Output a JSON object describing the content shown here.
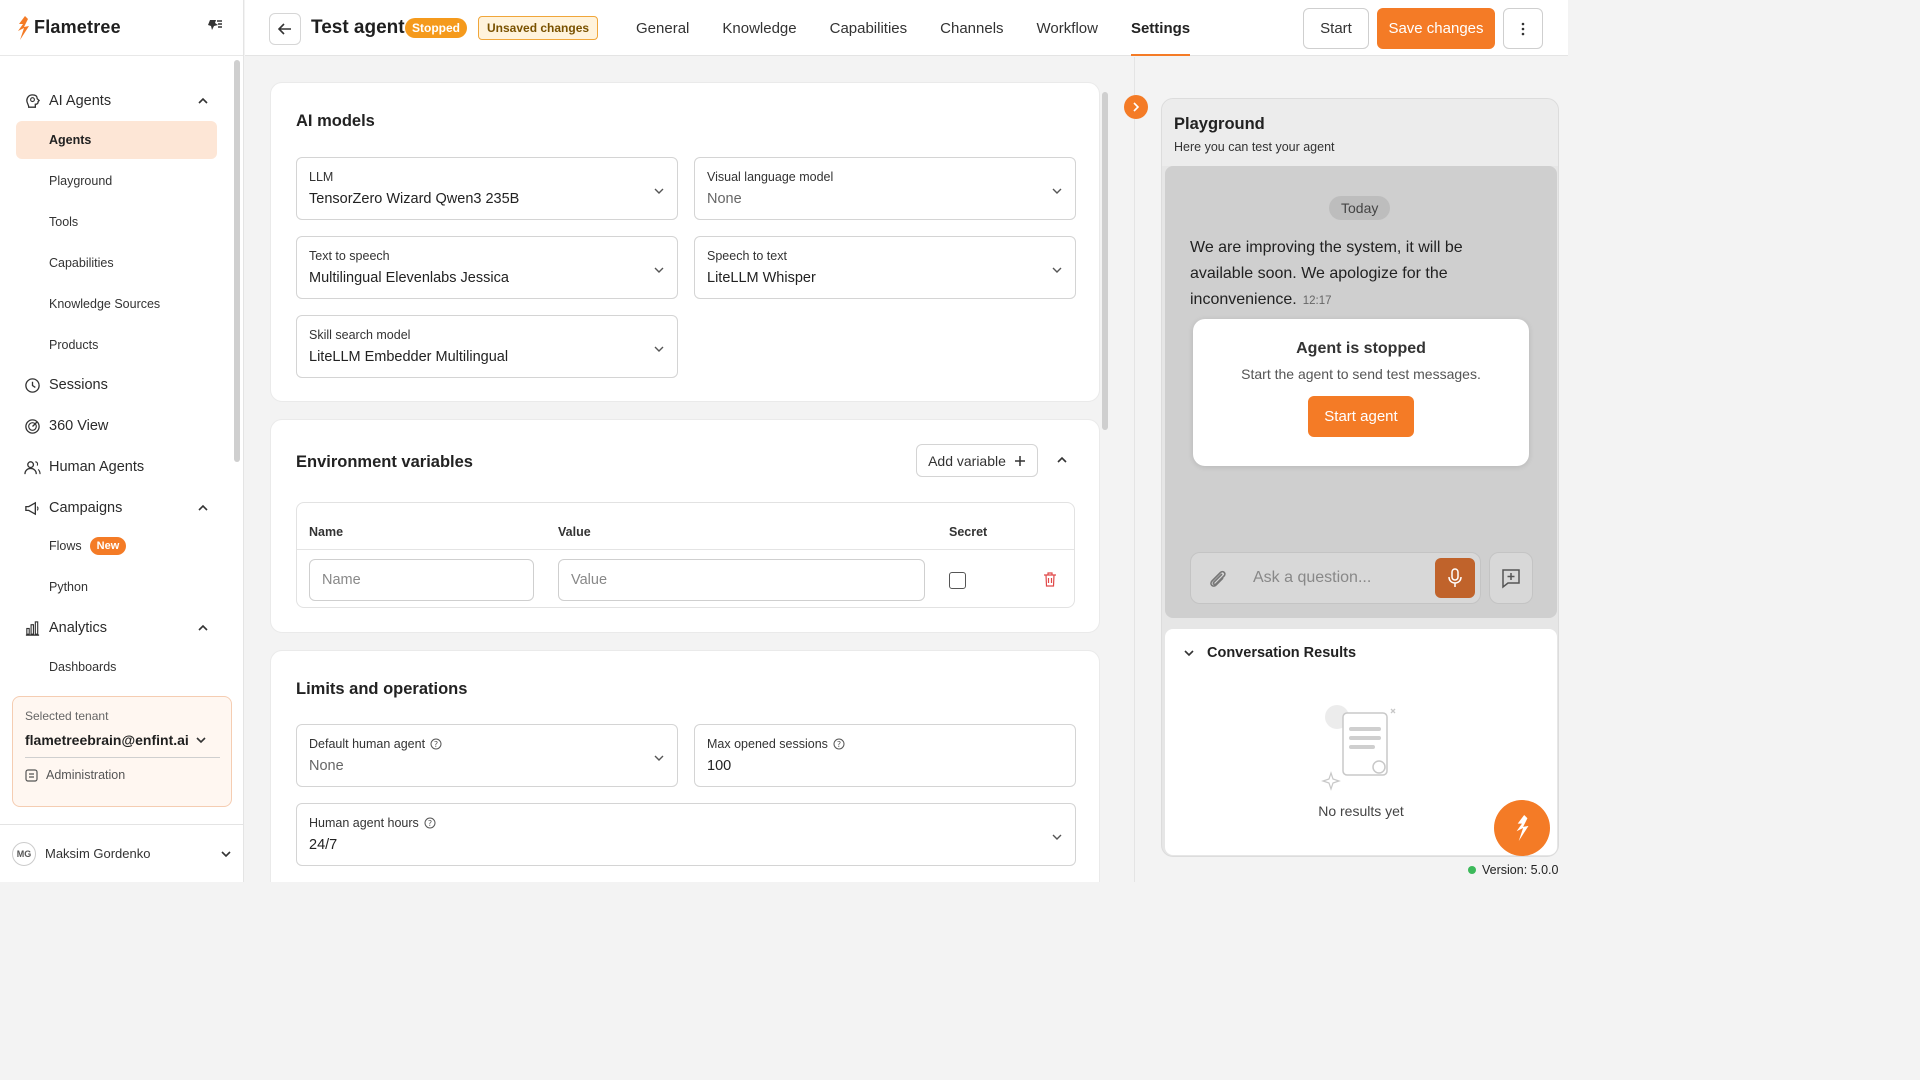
{
  "brand": {
    "name": "Flametree"
  },
  "sidebar": {
    "items": [
      {
        "label": "AI Agents",
        "icon": "brain-icon"
      },
      {
        "label": "Agents"
      },
      {
        "label": "Playground"
      },
      {
        "label": "Tools"
      },
      {
        "label": "Capabilities"
      },
      {
        "label": "Knowledge Sources"
      },
      {
        "label": "Products"
      },
      {
        "label": "Sessions",
        "icon": "clock-icon"
      },
      {
        "label": "360 View",
        "icon": "radar-icon"
      },
      {
        "label": "Human Agents",
        "icon": "users-icon"
      },
      {
        "label": "Campaigns",
        "icon": "megaphone-icon"
      },
      {
        "label": "Flows",
        "badge": "New"
      },
      {
        "label": "Python"
      },
      {
        "label": "Analytics",
        "icon": "chart-icon"
      },
      {
        "label": "Dashboards"
      }
    ],
    "tenant": {
      "caption": "Selected tenant",
      "value": "flametreebrain@enfint.ai",
      "admin": "Administration"
    },
    "user": {
      "initials": "MG",
      "name": "Maksim Gordenko"
    }
  },
  "header": {
    "title": "Test agent",
    "status": "Stopped",
    "unsaved": "Unsaved changes",
    "tabs": [
      "General",
      "Knowledge",
      "Capabilities",
      "Channels",
      "Workflow",
      "Settings"
    ],
    "active_tab": "Settings",
    "start_label": "Start",
    "save_label": "Save changes"
  },
  "ai_models": {
    "title": "AI models",
    "fields": [
      {
        "label": "LLM",
        "value": "TensorZero Wizard Qwen3 235B"
      },
      {
        "label": "Visual language model",
        "value": "None"
      },
      {
        "label": "Text to speech",
        "value": "Multilingual Elevenlabs Jessica"
      },
      {
        "label": "Speech to text",
        "value": "LiteLLM Whisper"
      },
      {
        "label": "Skill search model",
        "value": "LiteLLM Embedder Multilingual"
      }
    ]
  },
  "env": {
    "title": "Environment variables",
    "add_label": "Add variable",
    "columns": [
      "Name",
      "Value",
      "Secret"
    ],
    "name_placeholder": "Name",
    "value_placeholder": "Value"
  },
  "limits": {
    "title": "Limits and operations",
    "fields": [
      {
        "label": "Default human agent",
        "value": "None"
      },
      {
        "label": "Max opened sessions",
        "value": "100"
      },
      {
        "label": "Human agent hours",
        "value": "24/7"
      }
    ]
  },
  "playground": {
    "title": "Playground",
    "subtitle": "Here you can test your agent",
    "today": "Today",
    "message": "We are improving the system, it will be available soon. We apologize for the inconvenience.",
    "message_time": "12:17",
    "stopped_title": "Agent is stopped",
    "stopped_text": "Start the agent to send test messages.",
    "start_agent": "Start agent",
    "ask_placeholder": "Ask a question...",
    "results_title": "Conversation Results",
    "no_results": "No results yet"
  },
  "version": "Version: 5.0.0",
  "colors": {
    "accent": "#f47b26",
    "status_badge": "#f59a1c",
    "online": "#3cb95a"
  }
}
